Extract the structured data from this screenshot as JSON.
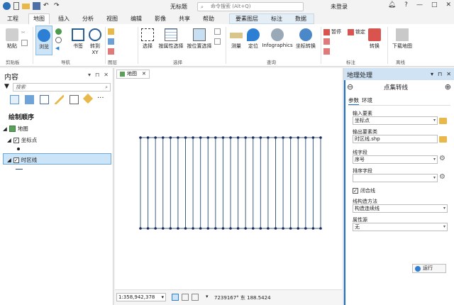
{
  "app": {
    "title": "无标题",
    "search_placeholder": "命令搜索 (Alt+Q)",
    "login": "未登录",
    "accent": "#1a73c8"
  },
  "tabs": [
    "工程",
    "地图",
    "插入",
    "分析",
    "视图",
    "编辑",
    "影像",
    "共享",
    "帮助",
    "要素图层",
    "标注",
    "数据"
  ],
  "ribbon": {
    "paste": "粘贴",
    "browse": "浏览",
    "bookmarks": "书签",
    "goto_xy": "转到 XY",
    "select": "选择",
    "select_by_attr": "按属性选择",
    "select_by_location": "按位置选择",
    "measure": "测量",
    "locate": "定位",
    "infographics": "Infographics",
    "coord_convert": "坐标转换",
    "pause": "暂停",
    "lock": "锁定",
    "convert": "转换",
    "download_map": "下载地图",
    "groups": {
      "clipboard": "剪贴板",
      "navigate": "导航",
      "layer": "图层",
      "selection": "选择",
      "inquiry": "查询",
      "labeling": "标注",
      "offline": "离线"
    }
  },
  "contents": {
    "title": "内容",
    "search_placeholder": "搜索",
    "drawing_order": "绘制顺序",
    "map_name": "地图",
    "layers": [
      {
        "name": "坐标点",
        "checked": true
      },
      {
        "name": "时区线",
        "checked": true
      }
    ]
  },
  "map": {
    "tab_label": "地图",
    "scale": "1:358,942,378",
    "coords": "7239167° 东 188.5424"
  },
  "geoprocessing": {
    "panel_title": "地理处理",
    "tool_title": "点集转线",
    "tab_params": "参数",
    "tab_env": "环境",
    "input_label": "输入要素",
    "input_value": "坐标点",
    "output_label": "输出要素类",
    "output_value": "时区线.shp",
    "line_field_label": "线字段",
    "line_field_value": "序号",
    "sort_field_label": "排序字段",
    "sort_field_value": "",
    "close_line_label": "闭合线",
    "line_method_label": "线构造方法",
    "line_method_value": "构造连续线",
    "attr_source_label": "属性源",
    "attr_source_value": "无",
    "run_label": "运行"
  }
}
